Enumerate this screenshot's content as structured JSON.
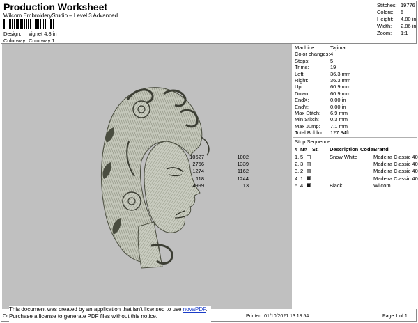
{
  "header": {
    "title": "Production Worksheet",
    "subtitle": "Wilcom EmbroideryStudio – Level 3 Advanced",
    "design_label": "Design:",
    "design_value": "vignet 4.8 in",
    "colorway_label": "Colorway:",
    "colorway_value": "Colorway 1"
  },
  "stats": [
    {
      "label": "Stitches:",
      "value": "19776"
    },
    {
      "label": "Colors:",
      "value": "5"
    },
    {
      "label": "Height:",
      "value": "4.80 in"
    },
    {
      "label": "Width:",
      "value": "2.86 in"
    },
    {
      "label": "Zoom:",
      "value": "1:1"
    }
  ],
  "properties": [
    {
      "label": "Machine:",
      "value": "Tajima"
    },
    {
      "label": "Color changes:",
      "value": "4"
    },
    {
      "label": "Stops:",
      "value": "5"
    },
    {
      "label": "Trims:",
      "value": "19"
    },
    {
      "label": "Left:",
      "value": "36.3 mm"
    },
    {
      "label": "Right:",
      "value": "36.3 mm"
    },
    {
      "label": "Up:",
      "value": "60.9 mm"
    },
    {
      "label": "Down:",
      "value": "60.9 mm"
    },
    {
      "label": "EndX:",
      "value": "0.00 in"
    },
    {
      "label": "EndY:",
      "value": "0.00 in"
    },
    {
      "label": "Max Stitch:",
      "value": "6.9 mm"
    },
    {
      "label": "Min Stitch:",
      "value": "0.3 mm"
    },
    {
      "label": "Max Jump:",
      "value": "7.1 mm"
    },
    {
      "label": "Total Bobbin:",
      "value": "127.34ft"
    }
  ],
  "stop_sequence": {
    "heading": "Stop Sequence:",
    "columns": [
      "#",
      "N#",
      "St.",
      "Description",
      "Code",
      "Brand"
    ],
    "rows": [
      {
        "num": "1.",
        "n": "5",
        "color": "#ffffff",
        "st": "10627",
        "desc": "Snow White",
        "code": "1002",
        "brand": "Madeira Classic 40"
      },
      {
        "num": "2.",
        "n": "3",
        "color": "#b4b4b4",
        "st": "2756",
        "desc": "",
        "code": "1339",
        "brand": "Madeira Classic 40"
      },
      {
        "num": "3.",
        "n": "2",
        "color": "#8c8c8c",
        "st": "1274",
        "desc": "",
        "code": "1162",
        "brand": "Madeira Classic 40"
      },
      {
        "num": "4.",
        "n": "1",
        "color": "#303030",
        "st": "118",
        "desc": "",
        "code": "1244",
        "brand": "Madeira Classic 40"
      },
      {
        "num": "5.",
        "n": "4",
        "color": "#151515",
        "st": "4999",
        "desc": "Black",
        "code": "13",
        "brand": "Wilcom"
      }
    ]
  },
  "footer": {
    "left": "Cr",
    "printed": "Printed: 01/10/2021 13.18.54",
    "page": "Page 1 of 1"
  },
  "notice": {
    "line1_pre": "This document was created by an application that isn't licensed to use ",
    "link": "novaPDF",
    "line1_post": ".",
    "line2": "Purchase a license to generate PDF files without this notice."
  },
  "colors": {
    "canvas": "#c0c0c0",
    "thread_dark": "#3c3e34",
    "thread_light": "#c6c9bd"
  }
}
